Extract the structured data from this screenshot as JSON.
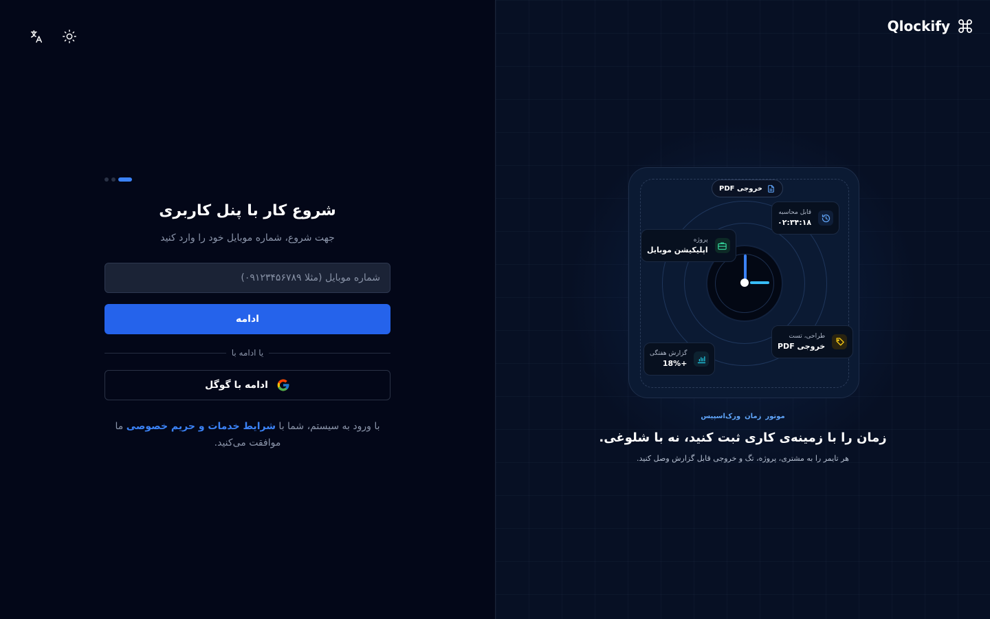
{
  "header": {
    "brand_name": "Qlockify",
    "icons": [
      "translate-icon",
      "sun-icon",
      "command-icon"
    ]
  },
  "signup": {
    "steps": {
      "total": 3,
      "current": 3
    },
    "title": "شروع کار با پنل کاربری",
    "subtitle": "جهت شروع، شماره موبایل خود را وارد کنید",
    "phone_placeholder": "شماره موبایل (مثلا ۰۹۱۲۳۴۵۶۷۸۹)",
    "continue_label": "ادامه",
    "divider_text": "یا ادامه با",
    "google_label": "ادامه با گوگل",
    "terms_prefix": "با ورود به سیستم، شما با",
    "terms_link": "شرایط خدمات و حریم خصوصی",
    "terms_suffix": "ما موافقت می‌کنید."
  },
  "showcase": {
    "pill_label": "خروجی PDF",
    "cards": {
      "billable": {
        "label": "قابل محاسبه",
        "value": "۰۲:۳۴:۱۸"
      },
      "project": {
        "label": "پروژه",
        "value": "اپلیکیشن موبایل"
      },
      "design": {
        "label": "طراحی، تست",
        "value": "خروجی PDF"
      },
      "weekly": {
        "label": "گزارش هفتگی",
        "value": "+18%"
      }
    },
    "tags": [
      "موتور",
      "زمان",
      "ورک‌اسپیس"
    ],
    "headline": "زمان را با زمینه‌ی کاری ثبت کنید، نه با شلوغی.",
    "tagline": "هر تایمر را به مشتری، پروژه، تگ و خروجی قابل گزارش وصل کنید."
  },
  "colors": {
    "accent": "#2563eb",
    "link": "#3b82f6",
    "background": "#030718"
  }
}
